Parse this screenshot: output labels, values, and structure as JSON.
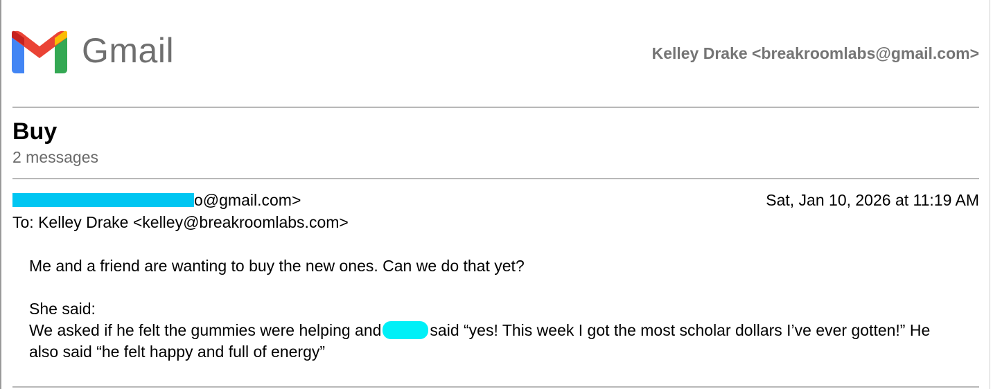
{
  "header": {
    "logo_text": "Gmail",
    "account": "Kelley Drake <breakroomlabs@gmail.com>"
  },
  "thread": {
    "subject": "Buy",
    "message_count": "2 messages"
  },
  "message": {
    "from_visible_suffix": "o@gmail.com>",
    "date": "Sat, Jan 10, 2026 at 11:19 AM",
    "to": "To: Kelley Drake <kelley@breakroomlabs.com>",
    "body": {
      "line1": "Me and a friend are wanting to buy the new ones. Can we do that yet?",
      "line2": "She said:",
      "line3_part1": "We asked if he felt the gummies were helping and",
      "line3_part2": "said “yes! This week I got the most scholar dollars I’ve ever gotten!” He also said “he felt happy and full of energy”"
    }
  },
  "colors": {
    "gmail_red": "#EA4335",
    "gmail_blue": "#4285F4",
    "gmail_green": "#34A853",
    "gmail_yellow": "#FBBC04",
    "redaction_blue": "#00C6F2",
    "redaction_cyan": "#00F0F7"
  }
}
